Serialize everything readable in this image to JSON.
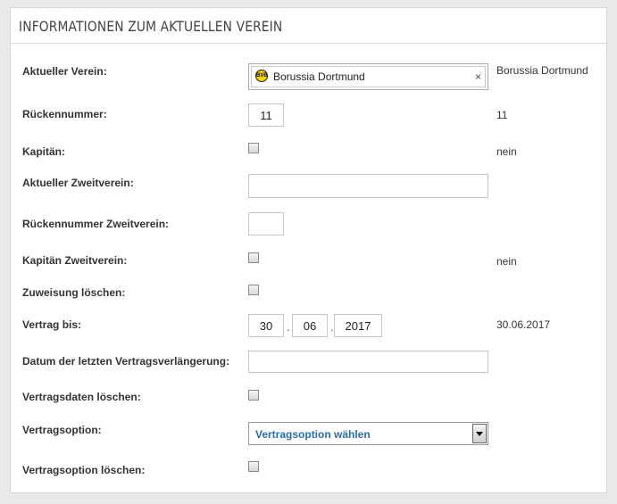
{
  "panel": {
    "title": "INFORMATIONEN ZUM AKTUELLEN VEREIN"
  },
  "fields": {
    "aktueller_verein": {
      "label": "Aktueller Verein:",
      "value": "Borussia Dortmund",
      "logo_text": "BVB",
      "clear_glyph": "×",
      "display": "Borussia Dortmund"
    },
    "rueckennummer": {
      "label": "Rückennummer:",
      "value": "11",
      "display": "11"
    },
    "kapitaen": {
      "label": "Kapitän:",
      "checked": false,
      "display": "nein"
    },
    "zweitverein": {
      "label": "Aktueller Zweitverein:",
      "value": ""
    },
    "rueckennummer_zweitverein": {
      "label": "Rückennummer Zweitverein:",
      "value": ""
    },
    "kapitaen_zweitverein": {
      "label": "Kapitän Zweitverein:",
      "checked": false,
      "display": "nein"
    },
    "zuweisung_loeschen": {
      "label": "Zuweisung löschen:",
      "checked": false
    },
    "vertrag_bis": {
      "label": "Vertrag bis:",
      "day": "30",
      "month": "06",
      "year": "2017",
      "separator": ".",
      "display": "30.06.2017"
    },
    "letzte_verlaengerung": {
      "label": "Datum der letzten Vertragsverlängerung:",
      "value": ""
    },
    "vertragsdaten_loeschen": {
      "label": "Vertragsdaten löschen:",
      "checked": false
    },
    "vertragsoption": {
      "label": "Vertragsoption:",
      "selected": "Vertragsoption wählen"
    },
    "vertragsoption_loeschen": {
      "label": "Vertragsoption löschen:",
      "checked": false
    }
  },
  "colors": {
    "link_blue": "#2a6da8",
    "panel_bg": "#ffffff",
    "page_bg": "#e9e9e9"
  }
}
